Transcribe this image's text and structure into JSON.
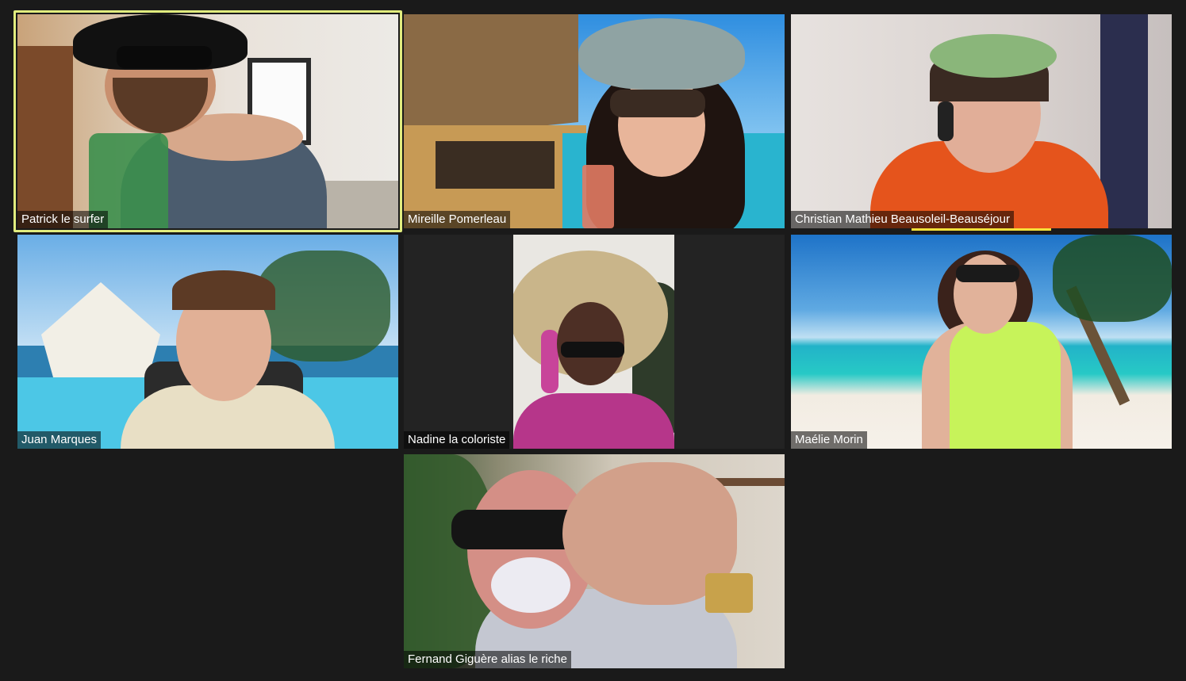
{
  "app": {
    "view": "gallery",
    "accent_colors": {
      "active_speaker_border": "#e1ec7e",
      "audio_indicator": "#f5e23a",
      "background": "#1a1a1a"
    }
  },
  "participants": [
    {
      "name": "Patrick le surfer",
      "active_speaker": true
    },
    {
      "name": "Mireille Pomerleau",
      "active_speaker": false
    },
    {
      "name": "Christian Mathieu Beausoleil-Beauséjour",
      "active_speaker": false,
      "speaking_indicator": true
    },
    {
      "name": "Juan Marques",
      "active_speaker": false
    },
    {
      "name": "Nadine la coloriste",
      "active_speaker": false
    },
    {
      "name": "Maélie Morin",
      "active_speaker": false
    },
    {
      "name": "Fernand Giguère alias le riche",
      "active_speaker": false
    }
  ]
}
